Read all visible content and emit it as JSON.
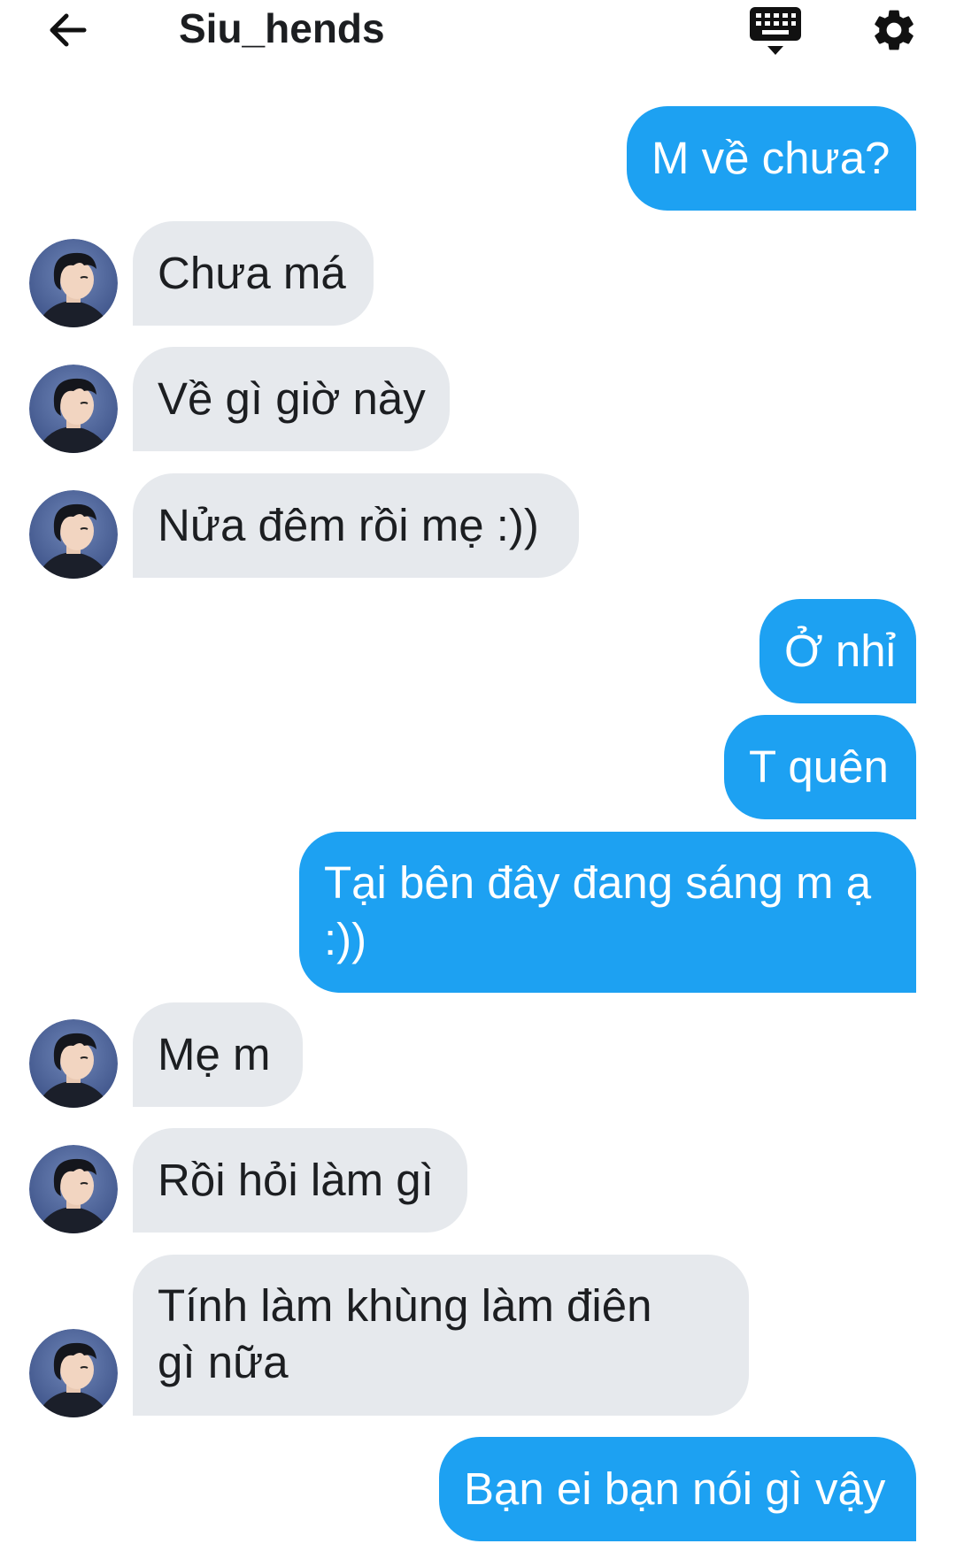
{
  "header": {
    "title": "Siu_hends",
    "back_icon": "arrow-left-icon",
    "keyboard_icon": "keyboard-icon",
    "settings_icon": "gear-icon"
  },
  "colors": {
    "outgoing_bubble": "#1da1f2",
    "incoming_bubble": "#e6e9ed",
    "outgoing_text": "#ffffff",
    "incoming_text": "#1c1e21"
  },
  "messages": [
    {
      "direction": "outgoing",
      "text": "M về chưa?"
    },
    {
      "direction": "incoming",
      "text": "Chưa má"
    },
    {
      "direction": "incoming",
      "text": "Về gì giờ này"
    },
    {
      "direction": "incoming",
      "text": "Nửa đêm rồi mẹ :))"
    },
    {
      "direction": "outgoing",
      "text": "Ở nhỉ"
    },
    {
      "direction": "outgoing",
      "text": "T quên"
    },
    {
      "direction": "outgoing",
      "text": "Tại bên đây đang sáng m ạ :))"
    },
    {
      "direction": "incoming",
      "text": "Mẹ m"
    },
    {
      "direction": "incoming",
      "text": "Rồi hỏi làm gì"
    },
    {
      "direction": "incoming",
      "text": "Tính làm khùng làm điên gì nữa"
    },
    {
      "direction": "outgoing",
      "text": "Bạn ei bạn nói gì vậy"
    }
  ]
}
